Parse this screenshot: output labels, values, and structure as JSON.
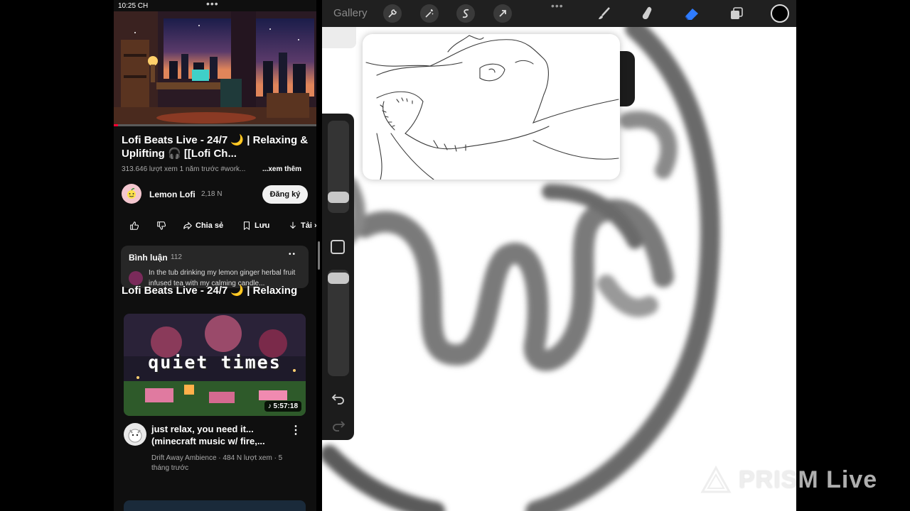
{
  "status_bar": {
    "time": "10:25 CH",
    "dots": "•••"
  },
  "youtube": {
    "video": {
      "title": "Lofi Beats Live - 24/7 🌙 | Relaxing & Uplifting 🎧 [[Lofi Ch...",
      "views": "313.646 lượt xem",
      "age": "1 năm trước",
      "hashtag": "#work...",
      "more_label": "...xem thêm",
      "progress": 0.02
    },
    "channel": {
      "name": "Lemon Lofi",
      "subscribers": "2,18 N",
      "subscribe_label": "Đăng ký"
    },
    "actions": {
      "share": "Chia sẻ",
      "save": "Lưu",
      "download": "Tải ›"
    },
    "comments": {
      "label": "Bình luận",
      "count": "112",
      "pager": "••",
      "top_comment": "In the tub drinking my lemon ginger herbal fruit infused tea with my calming candle..."
    },
    "miniplayer_title": "Lofi Beats Live - 24/7 🌙 | Relaxing",
    "recommended": {
      "thumb_text": "quiet times",
      "duration": "5:57:18",
      "title": "just relax, you need it... (minecraft music w/ fire,...",
      "meta": "Drift Away Ambience · 484 N lượt xem · 5 tháng trước",
      "more": "⋮"
    }
  },
  "procreate": {
    "gallery_label": "Gallery",
    "toolbar_dots": "•••",
    "active_tool": "eraser",
    "current_color": "#000000",
    "accent": "#2f7cff"
  },
  "watermark": {
    "text": "PRISM Live"
  }
}
